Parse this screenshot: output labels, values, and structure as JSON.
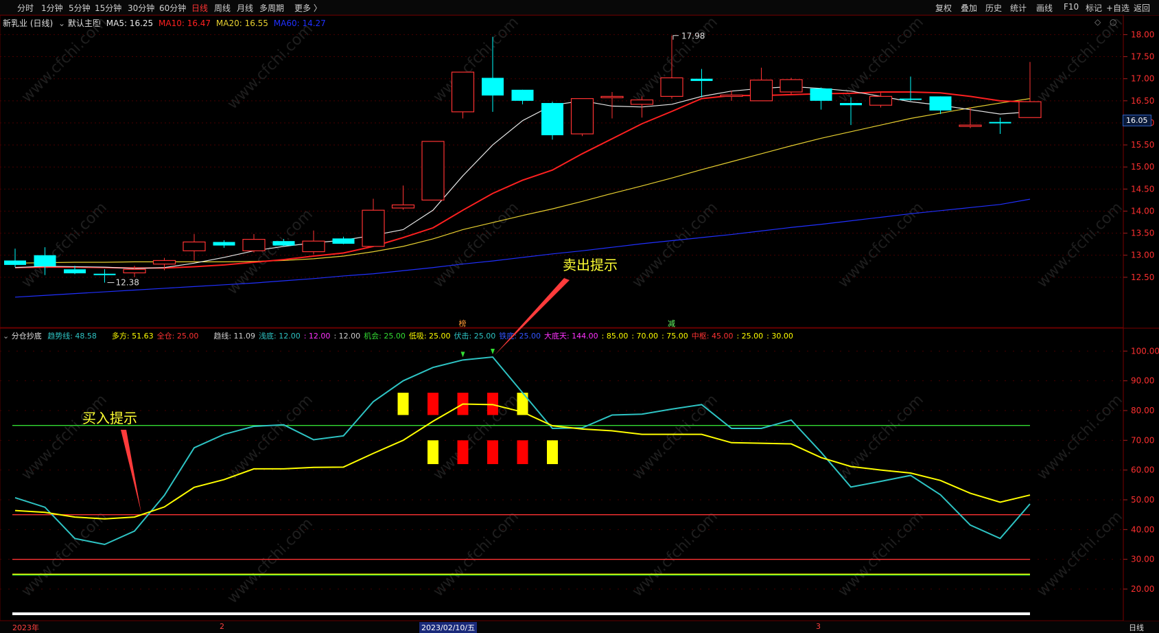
{
  "toolbar": {
    "periods": [
      "分时",
      "1分钟",
      "5分钟",
      "15分钟",
      "30分钟",
      "60分钟",
      "日线",
      "周线",
      "月线",
      "多周期",
      "更多 〉"
    ],
    "active_period": "日线",
    "right_buttons": [
      "复权",
      "叠加",
      "历史",
      "统计",
      "画线",
      "F10",
      "标记",
      "+自选",
      "返回"
    ]
  },
  "main_legend": {
    "stock": "新乳业 (日线)",
    "template": "默认主图",
    "ma5": "MA5: 16.25",
    "ma10": "MA10: 16.47",
    "ma20": "MA20: 16.55",
    "ma60": "MA60: 14.27"
  },
  "sub_legend": {
    "name": "分仓抄底",
    "items": [
      {
        "text": "趋势线: 48.58",
        "color": "#2ec4c4"
      },
      {
        "text": "多方: 51.63",
        "color": "#ffff00"
      },
      {
        "text": "全仓: 25.00",
        "color": "#ff3333"
      },
      {
        "text": "趋线: 11.09",
        "color": "#d0d0d0"
      },
      {
        "text": "浅底: 12.00",
        "color": "#2ec4c4"
      },
      {
        "text": ": 12.00",
        "color": "#ff33ff"
      },
      {
        "text": ": 12.00",
        "color": "#d0d0d0"
      },
      {
        "text": "机会: 25.00",
        "color": "#33dd33"
      },
      {
        "text": "低吸: 25.00",
        "color": "#ffff00"
      },
      {
        "text": "伏击: 25.00",
        "color": "#2ec4c4"
      },
      {
        "text": "铁底: 25.00",
        "color": "#3355ff"
      },
      {
        "text": "大底天: 144.00",
        "color": "#ff33ff"
      },
      {
        "text": ": 85.00",
        "color": "#ffff00"
      },
      {
        "text": ": 70.00",
        "color": "#ffff00"
      },
      {
        "text": ": 75.00",
        "color": "#ffff00"
      },
      {
        "text": "中枢: 45.00",
        "color": "#ff3333"
      },
      {
        "text": ": 25.00",
        "color": "#ffff00"
      },
      {
        "text": ": 30.00",
        "color": "#ffff00"
      }
    ]
  },
  "annotations": {
    "sell": "卖出提示",
    "buy": "买入提示",
    "high_label": "17.98",
    "low_label": "12.38",
    "marker_bang": "榜",
    "marker_jian": "减",
    "current_price": "16.05"
  },
  "bottom_axis": {
    "labels": [
      "2023年",
      "2",
      "2023/02/10/五",
      "3"
    ],
    "period_label": "日线"
  },
  "chart_data": [
    {
      "type": "candlestick",
      "title": "新乳业 (日线)",
      "ylim": [
        12.0,
        18.1
      ],
      "y_ticks": [
        12.5,
        13.0,
        13.5,
        14.0,
        14.5,
        15.0,
        15.5,
        16.0,
        16.5,
        17.0,
        17.5,
        18.0
      ],
      "candles": [
        {
          "o": 12.88,
          "h": 13.15,
          "l": 12.73,
          "c": 12.78
        },
        {
          "o": 13.0,
          "h": 13.18,
          "l": 12.55,
          "c": 12.75
        },
        {
          "o": 12.68,
          "h": 12.76,
          "l": 12.57,
          "c": 12.59
        },
        {
          "o": 12.58,
          "h": 12.68,
          "l": 12.38,
          "c": 12.55
        },
        {
          "o": 12.6,
          "h": 12.76,
          "l": 12.5,
          "c": 12.68
        },
        {
          "o": 12.8,
          "h": 12.94,
          "l": 12.66,
          "c": 12.88
        },
        {
          "o": 13.1,
          "h": 13.48,
          "l": 12.88,
          "c": 13.3
        },
        {
          "o": 13.3,
          "h": 13.34,
          "l": 13.17,
          "c": 13.22
        },
        {
          "o": 13.1,
          "h": 13.48,
          "l": 13.06,
          "c": 13.36
        },
        {
          "o": 13.32,
          "h": 13.37,
          "l": 13.2,
          "c": 13.22
        },
        {
          "o": 13.08,
          "h": 13.56,
          "l": 13.02,
          "c": 13.32
        },
        {
          "o": 13.38,
          "h": 13.42,
          "l": 13.25,
          "c": 13.26
        },
        {
          "o": 13.2,
          "h": 14.28,
          "l": 13.2,
          "c": 14.02
        },
        {
          "o": 14.07,
          "h": 14.58,
          "l": 14.03,
          "c": 14.14
        },
        {
          "o": 14.25,
          "h": 15.58,
          "l": 14.25,
          "c": 15.58
        },
        {
          "o": 16.25,
          "h": 17.05,
          "l": 16.1,
          "c": 17.15
        },
        {
          "o": 17.02,
          "h": 17.95,
          "l": 16.25,
          "c": 16.62
        },
        {
          "o": 16.75,
          "h": 16.75,
          "l": 16.42,
          "c": 16.5
        },
        {
          "o": 16.45,
          "h": 16.48,
          "l": 15.62,
          "c": 15.72
        },
        {
          "o": 15.75,
          "h": 16.55,
          "l": 15.7,
          "c": 16.55
        },
        {
          "o": 16.6,
          "h": 16.7,
          "l": 16.1,
          "c": 16.6
        },
        {
          "o": 16.42,
          "h": 16.6,
          "l": 16.12,
          "c": 16.52
        },
        {
          "o": 16.6,
          "h": 17.98,
          "l": 16.55,
          "c": 17.02
        },
        {
          "o": 17.0,
          "h": 17.22,
          "l": 16.58,
          "c": 16.95
        },
        {
          "o": 16.62,
          "h": 16.73,
          "l": 16.5,
          "c": 16.63
        },
        {
          "o": 16.5,
          "h": 17.25,
          "l": 16.5,
          "c": 16.97
        },
        {
          "o": 16.7,
          "h": 17.02,
          "l": 16.65,
          "c": 16.98
        },
        {
          "o": 16.78,
          "h": 16.8,
          "l": 16.3,
          "c": 16.5
        },
        {
          "o": 16.45,
          "h": 16.58,
          "l": 15.95,
          "c": 16.4
        },
        {
          "o": 16.4,
          "h": 16.68,
          "l": 16.35,
          "c": 16.6
        },
        {
          "o": 16.55,
          "h": 17.05,
          "l": 16.5,
          "c": 16.52
        },
        {
          "o": 16.6,
          "h": 16.6,
          "l": 16.2,
          "c": 16.28
        },
        {
          "o": 15.95,
          "h": 16.35,
          "l": 15.88,
          "c": 15.95
        },
        {
          "o": 16.02,
          "h": 16.12,
          "l": 15.75,
          "c": 16.0
        },
        {
          "o": 16.12,
          "h": 17.38,
          "l": 16.12,
          "c": 16.48
        }
      ],
      "ma5": [
        12.72,
        12.75,
        12.74,
        12.73,
        12.7,
        12.72,
        12.82,
        12.95,
        13.1,
        13.2,
        13.28,
        13.34,
        13.45,
        13.58,
        14.02,
        14.8,
        15.5,
        16.05,
        16.4,
        16.5,
        16.38,
        16.36,
        16.42,
        16.6,
        16.72,
        16.78,
        16.82,
        16.78,
        16.72,
        16.6,
        16.48,
        16.4,
        16.3,
        16.2,
        16.25
      ],
      "ma10": [
        12.72,
        12.73,
        12.73,
        12.72,
        12.71,
        12.71,
        12.74,
        12.78,
        12.84,
        12.9,
        12.98,
        13.05,
        13.2,
        13.4,
        13.62,
        14.02,
        14.4,
        14.7,
        14.93,
        15.3,
        15.64,
        15.98,
        16.26,
        16.55,
        16.62,
        16.62,
        16.64,
        16.66,
        16.67,
        16.7,
        16.7,
        16.68,
        16.6,
        16.5,
        16.47
      ],
      "ma20": [
        12.82,
        12.83,
        12.84,
        12.84,
        12.85,
        12.85,
        12.85,
        12.85,
        12.86,
        12.88,
        12.92,
        12.98,
        13.08,
        13.2,
        13.37,
        13.58,
        13.74,
        13.9,
        14.05,
        14.22,
        14.4,
        14.57,
        14.75,
        14.94,
        15.12,
        15.3,
        15.48,
        15.65,
        15.8,
        15.95,
        16.1,
        16.22,
        16.34,
        16.45,
        16.55
      ],
      "ma60": [
        12.05,
        12.09,
        12.13,
        12.17,
        12.21,
        12.25,
        12.29,
        12.33,
        12.37,
        12.42,
        12.47,
        12.53,
        12.58,
        12.65,
        12.72,
        12.8,
        12.87,
        12.95,
        13.03,
        13.1,
        13.18,
        13.26,
        13.33,
        13.4,
        13.47,
        13.55,
        13.63,
        13.7,
        13.78,
        13.86,
        13.94,
        14.01,
        14.08,
        14.15,
        14.27
      ]
    },
    {
      "type": "line",
      "title": "分仓抄底",
      "ylim": [
        14,
        104
      ],
      "y_ticks": [
        20,
        30,
        40,
        50,
        60,
        70,
        80,
        90,
        100
      ],
      "series": [
        {
          "name": "趋势线",
          "color": "#2ec4c4",
          "values": [
            50.7,
            47.5,
            37.0,
            35.0,
            39.5,
            51.5,
            67.5,
            72.0,
            74.7,
            75.2,
            70.2,
            71.5,
            83.0,
            90.0,
            94.5,
            97.0,
            98.0,
            86.0,
            74.0,
            74.2,
            78.5,
            78.8,
            80.5,
            82.0,
            74.0,
            74.0,
            76.8,
            66.0,
            54.3,
            56.2,
            58.2,
            51.7,
            41.5,
            37.0,
            48.6
          ]
        },
        {
          "name": "多方",
          "color": "#ffff00",
          "values": [
            46.4,
            45.8,
            44.2,
            43.6,
            44.2,
            47.6,
            54.2,
            56.8,
            60.4,
            60.4,
            60.9,
            61.0,
            65.6,
            70.0,
            76.4,
            82.2,
            82.0,
            79.5,
            74.9,
            73.8,
            73.2,
            72.0,
            72.0,
            72.0,
            69.2,
            69.0,
            68.8,
            64.2,
            61.2,
            60.0,
            59.0,
            56.5,
            52.2,
            49.2,
            51.6
          ]
        }
      ],
      "hlines": [
        {
          "value": 75,
          "color": "#33dd33"
        },
        {
          "value": 45,
          "color": "#ff3333"
        },
        {
          "value": 30,
          "color": "#ff3333"
        },
        {
          "value": 25,
          "color": "#ffff00"
        },
        {
          "value": 24.7,
          "color": "#33dd33"
        }
      ],
      "upper_blocks": [
        {
          "i": 13,
          "color": "#ffff00"
        },
        {
          "i": 14,
          "color": "#ff0000"
        },
        {
          "i": 15,
          "color": "#ff0000"
        },
        {
          "i": 16,
          "color": "#ff0000"
        },
        {
          "i": 17,
          "color": "#ffff00"
        }
      ],
      "lower_blocks": [
        {
          "i": 14,
          "color": "#ffff00"
        },
        {
          "i": 15,
          "color": "#ff0000"
        },
        {
          "i": 16,
          "color": "#ff0000"
        },
        {
          "i": 17,
          "color": "#ff0000"
        },
        {
          "i": 18,
          "color": "#ffff00"
        }
      ],
      "upper_block_range": [
        78.5,
        86
      ],
      "lower_block_range": [
        62,
        70
      ]
    }
  ],
  "colors": {
    "up": "#ff3333",
    "down": "#00ffff",
    "ma5": "#e8e8e8",
    "ma10": "#ff2020",
    "ma20": "#e8d030",
    "ma60": "#2030ff"
  }
}
